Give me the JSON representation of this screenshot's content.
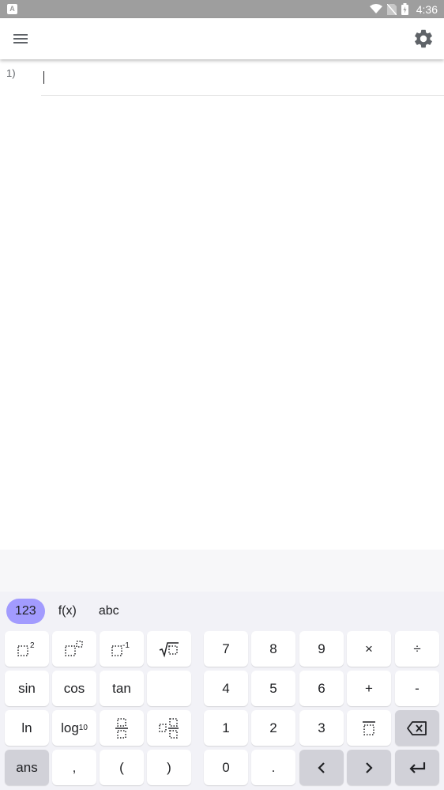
{
  "status_bar": {
    "time": "4:36",
    "notification_label": "A"
  },
  "app_bar": {
    "menu_icon": "hamburger-menu-icon",
    "settings_icon": "gear-icon"
  },
  "worksheet": {
    "rows": [
      {
        "number": "1)",
        "expression": ""
      }
    ]
  },
  "keyboard": {
    "tabs": [
      {
        "label": "123",
        "active": true
      },
      {
        "label": "f(x)",
        "active": false
      },
      {
        "label": "abc",
        "active": false
      }
    ],
    "keys": {
      "seven": "7",
      "eight": "8",
      "nine": "9",
      "times": "×",
      "divide": "÷",
      "sin": "sin",
      "cos": "cos",
      "tan": "tan",
      "four": "4",
      "five": "5",
      "six": "6",
      "plus": "+",
      "minus": "-",
      "ln": "ln",
      "log_base": "log",
      "log_sub": "10",
      "one": "1",
      "two": "2",
      "three": "3",
      "ans": "ans",
      "comma": ",",
      "open_paren": "(",
      "close_paren": ")",
      "zero": "0",
      "dot": ".",
      "square_superscript": "2",
      "inverse_superscript": "-1"
    },
    "icons": {
      "square": "square-template-icon",
      "power": "power-template-icon",
      "inverse": "inverse-template-icon",
      "sqrt": "sqrt-template-icon",
      "fraction": "fraction-template-icon",
      "mixed_fraction": "mixed-fraction-template-icon",
      "overline": "overline-template-icon",
      "backspace": "backspace-icon",
      "left": "arrow-left-icon",
      "right": "arrow-right-icon",
      "enter": "enter-icon"
    },
    "accent_color": "#a29bfe"
  }
}
